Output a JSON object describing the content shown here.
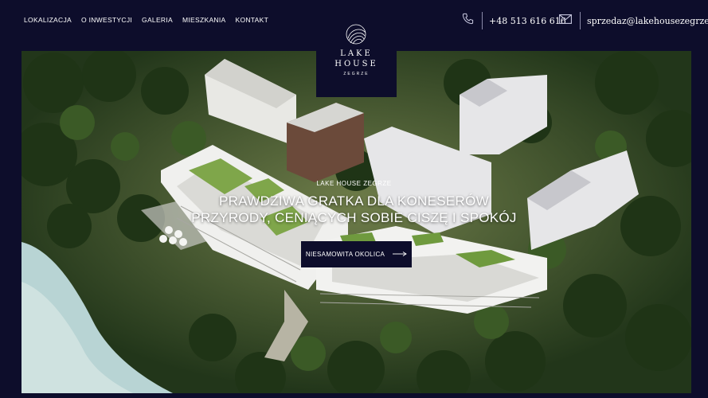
{
  "nav": {
    "items": [
      {
        "label": "LOKALIZACJA"
      },
      {
        "label": "O INWESTYCJI"
      },
      {
        "label": "GALERIA"
      },
      {
        "label": "MIESZKANIA"
      },
      {
        "label": "KONTAKT"
      }
    ]
  },
  "contact": {
    "phone": "+48 513 616 616",
    "email": "sprzedaz@lakehousezegrze.pl",
    "phone_icon": "phone-icon",
    "email_icon": "envelope-icon"
  },
  "logo": {
    "line1": "LAKE",
    "line2": "HOUSE",
    "line3": "ZEGRZE",
    "icon": "shell-icon"
  },
  "hero": {
    "subtitle": "LAKE HOUSE ZEGRZE",
    "headline_1": "PRAWDZIWA GRATKA DLA KONESERÓW",
    "headline_2": "PRZYRODY, CENIĄCYCH SOBIE CISZĘ I SPOKÓJ",
    "cta_label": "NIESAMOWITA OKOLICA",
    "cta_icon": "arrow-right-icon"
  },
  "colors": {
    "navy": "#0d0d2b",
    "forest": "#2f4a22",
    "lake": "#b8d4d4"
  }
}
